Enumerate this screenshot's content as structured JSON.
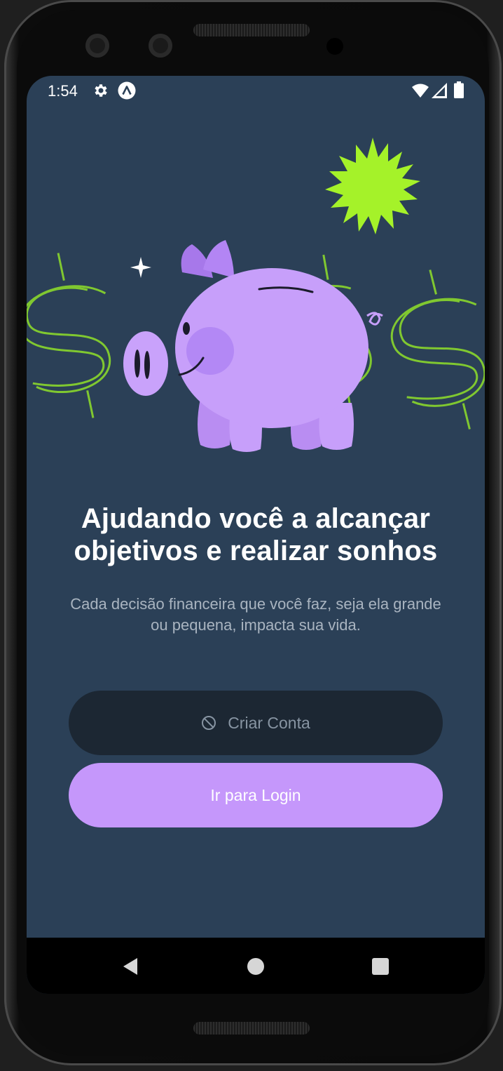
{
  "status_bar": {
    "time": "1:54",
    "icons": [
      "gear-icon",
      "app-a-icon",
      "wifi-icon",
      "cell-signal-icon",
      "battery-icon"
    ]
  },
  "hero": {
    "illustration": "piggy-bank-with-dollar-signs"
  },
  "content": {
    "title": "Ajudando você a alcançar objetivos e realizar sonhos",
    "subtitle": "Cada decisão financeira que você faz, seja ela grande ou pequena, impacta sua vida."
  },
  "actions": {
    "create_account_label": "Criar Conta",
    "create_account_icon": "block-icon",
    "login_label": "Ir para Login"
  },
  "nav_bar": {
    "buttons": [
      "back-icon",
      "home-icon",
      "recents-icon"
    ]
  },
  "colors": {
    "background": "#2b4057",
    "primary": "#c597fb",
    "disabled_button": "#1c2733",
    "accent_green": "#a5f229"
  }
}
